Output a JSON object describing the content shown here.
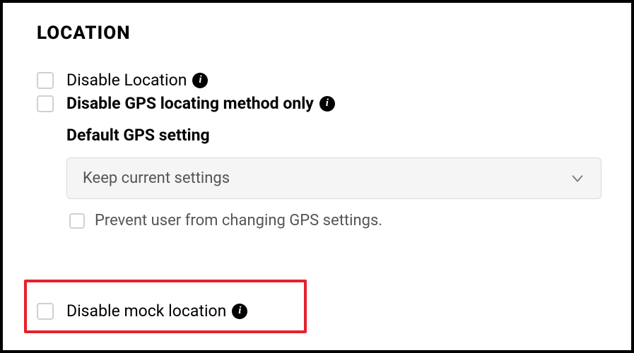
{
  "section": {
    "title": "LOCATION"
  },
  "options": {
    "disable_location": {
      "label": "Disable Location"
    },
    "disable_gps_only": {
      "label": "Disable GPS locating method only"
    },
    "default_gps_heading": "Default GPS setting",
    "default_gps_select": {
      "value": "Keep current settings"
    },
    "prevent_change": {
      "label": "Prevent user from changing GPS settings."
    },
    "disable_mock": {
      "label": "Disable mock location"
    }
  }
}
